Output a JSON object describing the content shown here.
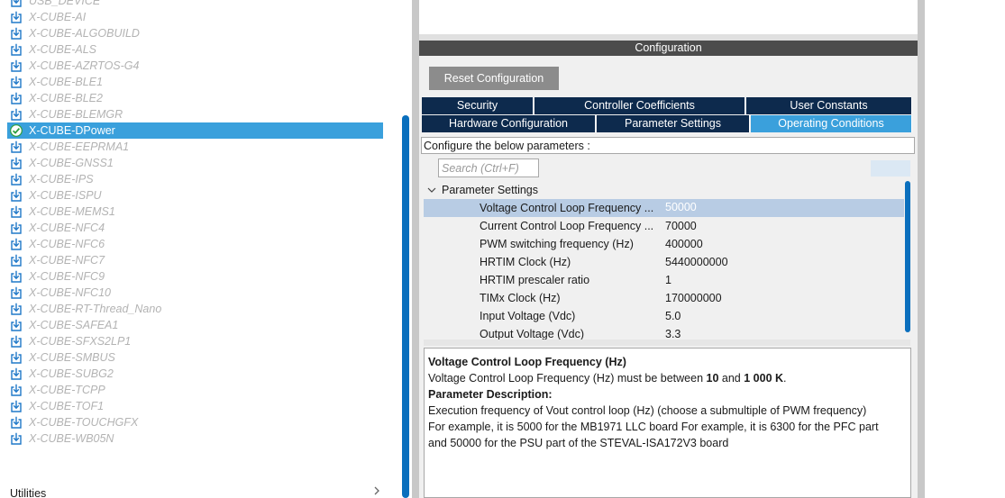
{
  "packages": {
    "items": [
      {
        "label": "USB_DEVICE",
        "selected": false
      },
      {
        "label": "X-CUBE-AI",
        "selected": false
      },
      {
        "label": "X-CUBE-ALGOBUILD",
        "selected": false
      },
      {
        "label": "X-CUBE-ALS",
        "selected": false
      },
      {
        "label": "X-CUBE-AZRTOS-G4",
        "selected": false
      },
      {
        "label": "X-CUBE-BLE1",
        "selected": false
      },
      {
        "label": "X-CUBE-BLE2",
        "selected": false
      },
      {
        "label": "X-CUBE-BLEMGR",
        "selected": false
      },
      {
        "label": "X-CUBE-DPower",
        "selected": true
      },
      {
        "label": "X-CUBE-EEPRMA1",
        "selected": false
      },
      {
        "label": "X-CUBE-GNSS1",
        "selected": false
      },
      {
        "label": "X-CUBE-IPS",
        "selected": false
      },
      {
        "label": "X-CUBE-ISPU",
        "selected": false
      },
      {
        "label": "X-CUBE-MEMS1",
        "selected": false
      },
      {
        "label": "X-CUBE-NFC4",
        "selected": false
      },
      {
        "label": "X-CUBE-NFC6",
        "selected": false
      },
      {
        "label": "X-CUBE-NFC7",
        "selected": false
      },
      {
        "label": "X-CUBE-NFC9",
        "selected": false
      },
      {
        "label": "X-CUBE-NFC10",
        "selected": false
      },
      {
        "label": "X-CUBE-RT-Thread_Nano",
        "selected": false
      },
      {
        "label": "X-CUBE-SAFEA1",
        "selected": false
      },
      {
        "label": "X-CUBE-SFXS2LP1",
        "selected": false
      },
      {
        "label": "X-CUBE-SMBUS",
        "selected": false
      },
      {
        "label": "X-CUBE-SUBG2",
        "selected": false
      },
      {
        "label": "X-CUBE-TCPP",
        "selected": false
      },
      {
        "label": "X-CUBE-TOF1",
        "selected": false
      },
      {
        "label": "X-CUBE-TOUCHGFX",
        "selected": false
      },
      {
        "label": "X-CUBE-WB05N",
        "selected": false
      }
    ],
    "utilities_label": "Utilities"
  },
  "config": {
    "header": "Configuration",
    "reset_label": "Reset Configuration",
    "tabs_row1": [
      "Security",
      "Controller Coefficients",
      "User Constants"
    ],
    "tabs_row2": [
      "Hardware Configuration",
      "Parameter Settings",
      "Operating Conditions"
    ],
    "active_tab": "Operating Conditions",
    "configure_label": "Configure the below parameters :",
    "search_placeholder": "Search (Ctrl+F)",
    "group_label": "Parameter Settings",
    "params": [
      {
        "name": "Voltage Control Loop Frequency ...",
        "value": "50000"
      },
      {
        "name": "Current Control Loop Frequency ...",
        "value": "70000"
      },
      {
        "name": "PWM switching frequency (Hz)",
        "value": "400000"
      },
      {
        "name": "HRTIM Clock (Hz)",
        "value": "5440000000"
      },
      {
        "name": "HRTIM prescaler ratio",
        "value": "1"
      },
      {
        "name": "TIMx Clock (Hz)",
        "value": "170000000"
      },
      {
        "name": "Input Voltage (Vdc)",
        "value": "5.0"
      },
      {
        "name": "Output Voltage (Vdc)",
        "value": "3.3"
      }
    ],
    "description": {
      "title": "Voltage Control Loop Frequency (Hz)",
      "range_prefix": "Voltage Control Loop Frequency (Hz) must be between ",
      "range_min": "10",
      "range_and": " and ",
      "range_max": "1 000 K",
      "range_suffix": ".",
      "desc_heading": "Parameter Description:",
      "line1": "Execution frequency of Vout control loop (Hz) (choose a submultiple of PWM frequency)",
      "line2": "For example, it is 5000 for the MB1971 LLC board For example, it is 6300 for the PFC part",
      "line3": "and 50000 for the PSU part of the STEVAL-ISA172V3 board"
    }
  },
  "colors": {
    "selection": "#3aa0dc",
    "tab_dark": "#0d2a4d",
    "scroll_thumb": "#0a6fbd",
    "package_icon": "#1f78c8",
    "check_green": "#2e9e3e"
  }
}
